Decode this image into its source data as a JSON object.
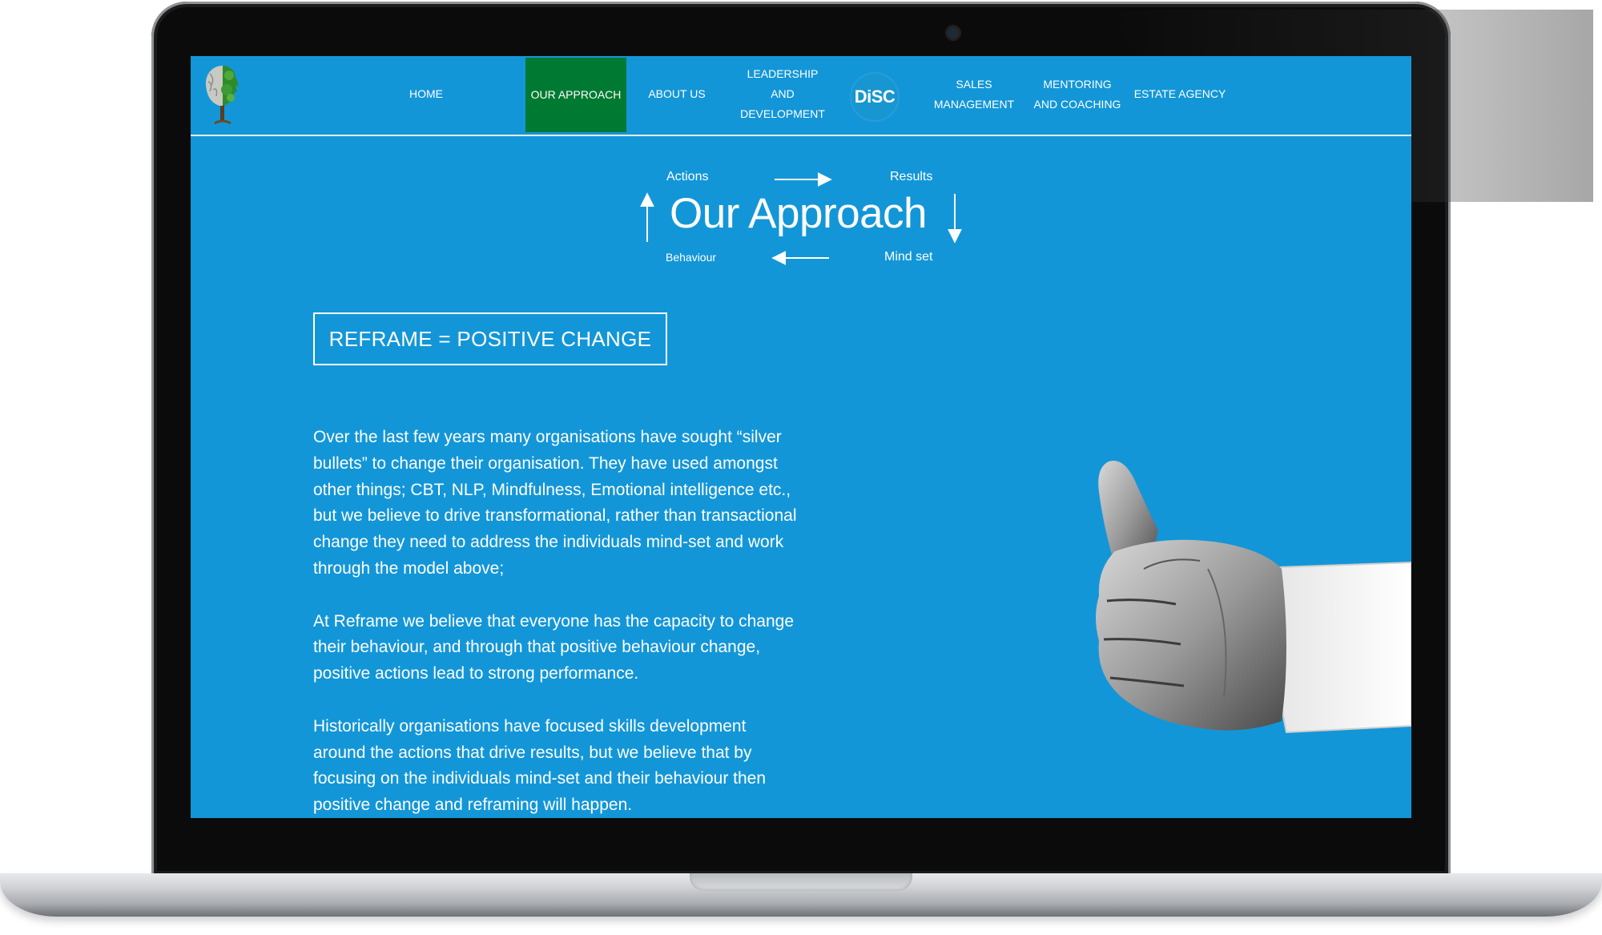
{
  "nav": {
    "items": [
      {
        "label": "HOME"
      },
      {
        "label": "OUR APPROACH"
      },
      {
        "label": "ABOUT US"
      },
      {
        "label": "LEADERSHIP\nAND\nDEVELOPMENT"
      },
      {
        "label": "DiSC"
      },
      {
        "label": "SALES\nMANAGEMENT"
      },
      {
        "label": "MENTORING\nAND COACHING"
      },
      {
        "label": "ESTATE AGENCY"
      }
    ],
    "active_index": 1,
    "active_color": "#007a32"
  },
  "diagram": {
    "title": "Our Approach",
    "top_left": "Actions",
    "top_right": "Results",
    "bottom_left": "Behaviour",
    "bottom_right": "Mind set"
  },
  "tagline": "REFRAME = POSITIVE CHANGE",
  "body": {
    "paragraphs": [
      "Over the last few years many organisations have sought “silver bullets” to change their organisation. They have used amongst other things; CBT, NLP, Mindfulness, Emotional intelligence etc., but we believe to drive transformational, rather than transactional change they need to address the individuals mind-set and work through the model above;",
      "At Reframe we believe that everyone has the capacity to change their behaviour, and through that positive behaviour change, positive actions lead to strong performance.",
      "Historically organisations have focused skills development around the actions that drive results, but we believe that by focusing on the individuals mind-set and their behaviour then positive change and reframing will happen."
    ]
  },
  "colors": {
    "background": "#1396d8",
    "text": "#ffffff",
    "accent": "#007a32"
  },
  "icons": [
    "tree-head-logo",
    "thumbs-up-hand-image",
    "webcam-icon"
  ]
}
